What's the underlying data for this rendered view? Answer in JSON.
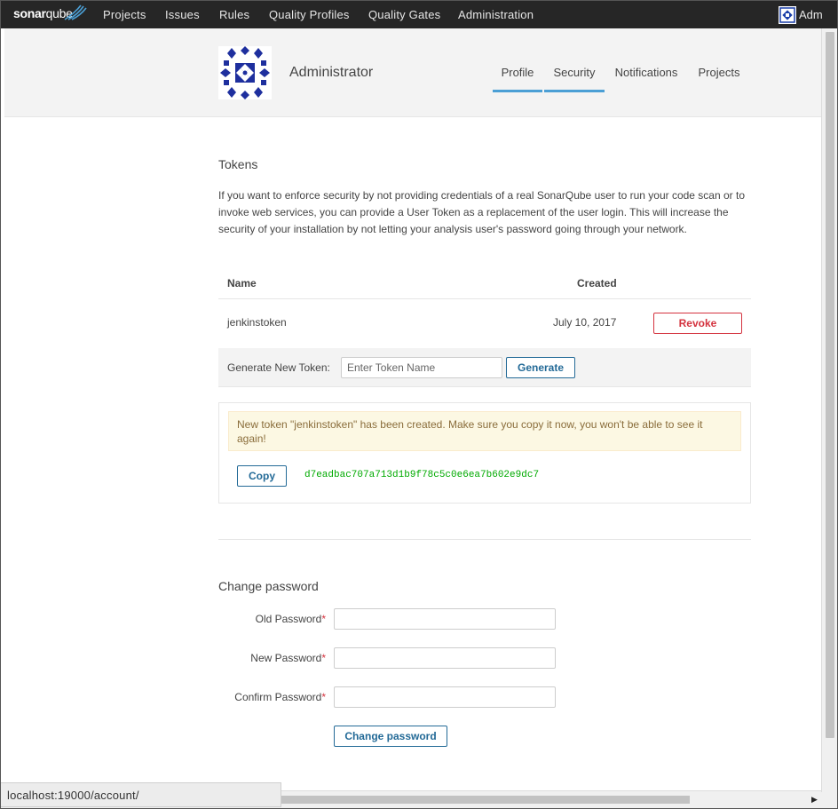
{
  "navbar": {
    "logo_bold": "sonar",
    "logo_rest": "qube",
    "links": [
      "Projects",
      "Issues",
      "Rules",
      "Quality Profiles",
      "Quality Gates",
      "Administration"
    ],
    "user_label": "Adm"
  },
  "account": {
    "name": "Administrator",
    "tabs": [
      "Profile",
      "Security",
      "Notifications",
      "Projects"
    ]
  },
  "tokens": {
    "title": "Tokens",
    "description": "If you want to enforce security by not providing credentials of a real SonarQube user to run your code scan or to invoke web services, you can provide a User Token as a replacement of the user login. This will increase the security of your installation by not letting your analysis user's password going through your network.",
    "columns": {
      "name": "Name",
      "created": "Created"
    },
    "rows": [
      {
        "name": "jenkinstoken",
        "created": "July 10, 2017",
        "action": "Revoke"
      }
    ],
    "generate_label": "Generate New Token:",
    "generate_placeholder": "Enter Token Name",
    "generate_button": "Generate",
    "new_token_alert": "New token \"jenkinstoken\" has been created. Make sure you copy it now, you won't be able to see it again!",
    "copy_button": "Copy",
    "token_value": "d7eadbac707a713d1b9f78c5c0e6ea7b602e9dc7"
  },
  "change_password": {
    "title": "Change password",
    "old_label": "Old Password",
    "new_label": "New Password",
    "confirm_label": "Confirm Password",
    "required_mark": "*",
    "submit": "Change password"
  },
  "status_bar": {
    "url": "localhost:19000/account/"
  },
  "colors": {
    "accent": "#4b9fd5",
    "button": "#236a97",
    "danger": "#d4333f",
    "token_green": "#00aa00",
    "navbar": "#262626"
  }
}
